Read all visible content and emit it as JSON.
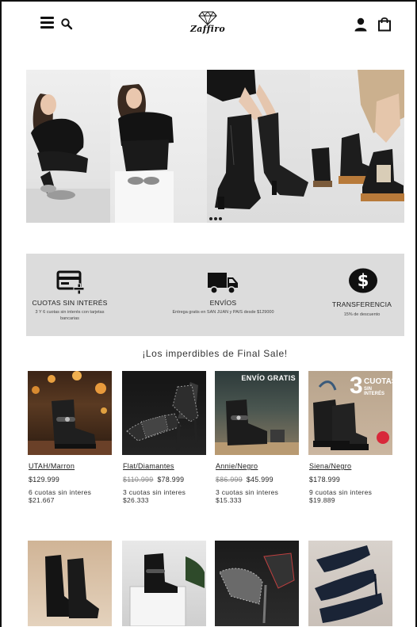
{
  "header": {
    "logo_text": "Zaffiro",
    "icons": {
      "menu": "hamburger-menu-icon",
      "search": "search-icon",
      "logo": "diamond-logo-icon",
      "user": "user-icon",
      "bag": "shopping-bag-icon"
    }
  },
  "hero": {
    "dots": 3
  },
  "benefits": [
    {
      "icon": "credit-card-plus-icon",
      "title": "CUOTAS SIN INTERÉS",
      "subtitle": "3 Y 6 cuotas sin interés con tarjetas bancarias"
    },
    {
      "icon": "truck-icon",
      "title": "ENVÍOS",
      "subtitle": "Entrega gratis en SAN JUAN y PAIS desde $129000"
    },
    {
      "icon": "dollar-circle-icon",
      "title": "TRANSFERENCIA",
      "subtitle": "15% de descuento"
    }
  ],
  "section_title": "¡Los imperdibles de Final Sale!",
  "products": [
    {
      "name": "UTAH/Marron",
      "old_price": "",
      "price": "$129.999",
      "installments_line1": "6 cuotas sin interes",
      "installments_line2": "$21.667"
    },
    {
      "name": "Flat/Diamantes",
      "old_price": "$110.999",
      "price": "$78.999",
      "installments_line1": "3 cuotas sin interes",
      "installments_line2": "$26.333"
    },
    {
      "name": "Annie/Negro",
      "old_price": "$86.999",
      "price": "$45.999",
      "installments_line1": "3 cuotas sin interes",
      "installments_line2": "$15.333",
      "badge": "ENVÍO GRATIS"
    },
    {
      "name": "Siena/Negro",
      "old_price": "",
      "price": "$178.999",
      "installments_line1": "9 cuotas sin interes",
      "installments_line2": "$19.889",
      "badge_big": "3",
      "badge_word": "CUOTAS",
      "badge_sub": "SIN INTERÉS"
    }
  ],
  "colors": {
    "benefits_bg": "#dcdcdc",
    "text": "#222222",
    "old_price": "#888888"
  }
}
